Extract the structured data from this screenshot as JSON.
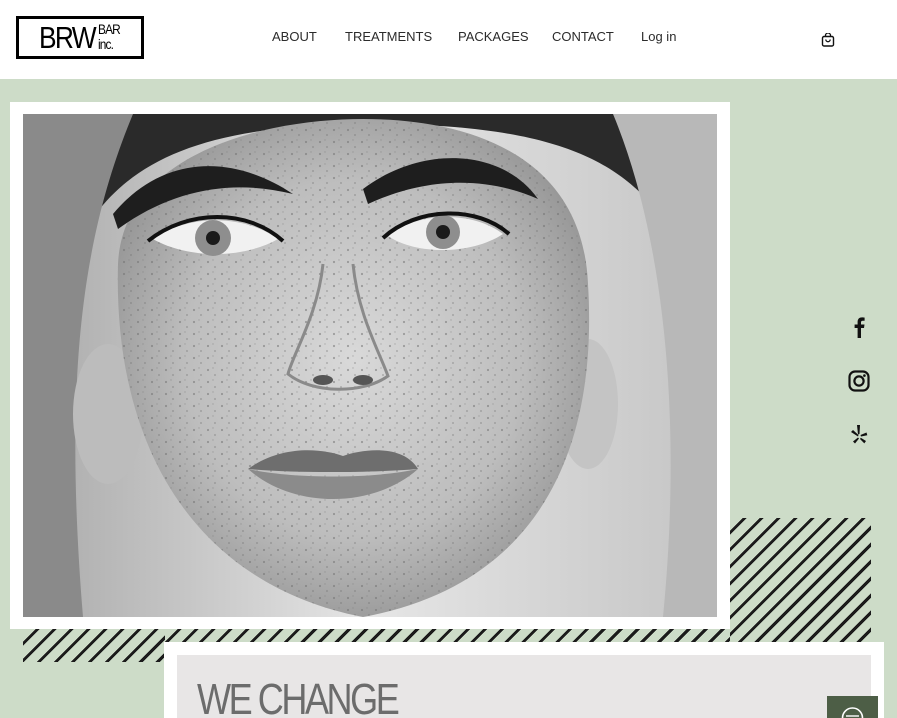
{
  "logo": {
    "main": "BRW",
    "bar": "BAR",
    "inc": "inc."
  },
  "nav": {
    "items": [
      {
        "label": "ABOUT"
      },
      {
        "label": "TREATMENTS"
      },
      {
        "label": "PACKAGES"
      },
      {
        "label": "CONTACT"
      },
      {
        "label": "Log in"
      }
    ]
  },
  "icons": {
    "cart": "shopping-bag-icon",
    "facebook": "facebook-icon",
    "instagram": "instagram-icon",
    "yelp": "yelp-icon",
    "chat": "chat-icon"
  },
  "hero": {
    "image_subject": "black-and-white close-up portrait of freckled woman"
  },
  "section": {
    "headline": "WE CHANGE"
  },
  "colors": {
    "band": "#cddcc8",
    "chat": "#4d5e46",
    "headline": "#6c6c6c"
  }
}
